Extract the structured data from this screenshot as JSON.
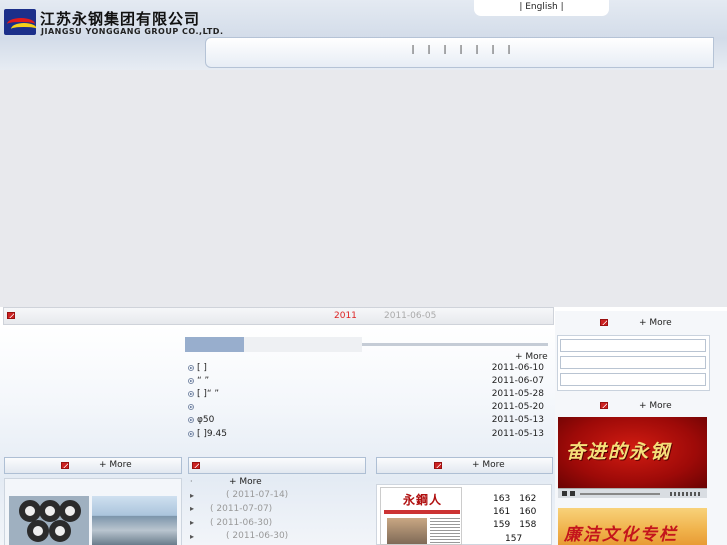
{
  "header": {
    "company_cn": "江苏永钢集团有限公司",
    "company_en": "JIANGSU YONGGANG GROUP CO.,LTD.",
    "lang_link": "| English |",
    "nav_separators": [
      "|",
      "|",
      "|",
      "|",
      "|",
      "|",
      "|"
    ]
  },
  "notice": {
    "year": "2011",
    "date": "2011-06-05"
  },
  "news": {
    "more_label": "+ More",
    "items": [
      {
        "title": "[ ]",
        "date": "2011-06-10"
      },
      {
        "title": "“ ”",
        "date": "2011-06-07"
      },
      {
        "title": "[ ]“ ”",
        "date": "2011-05-28"
      },
      {
        "title": "",
        "date": "2011-05-20"
      },
      {
        "title": "φ50",
        "date": "2011-05-13"
      },
      {
        "title": "[ ]9.45",
        "date": "2011-05-13"
      }
    ]
  },
  "products": {
    "more_label": "+ More"
  },
  "list2": {
    "more_label": "+ More",
    "items": [
      {
        "bullet": "·",
        "date": ""
      },
      {
        "bullet": "▸",
        "date": "( 2011-07-14)"
      },
      {
        "bullet": "▸",
        "date": "( 2011-07-07)"
      },
      {
        "bullet": "▸",
        "date": "( 2011-06-30)"
      },
      {
        "bullet": "▸",
        "date": "( 2011-06-30)"
      }
    ]
  },
  "newspaper": {
    "more_label": "+ More",
    "masthead": "永鋼人",
    "issues": [
      [
        "163",
        "162"
      ],
      [
        "161",
        "160"
      ],
      [
        "159",
        "158"
      ],
      [
        "157"
      ]
    ]
  },
  "right": {
    "more_label_1": "+ More",
    "more_label_2": "+ More",
    "video_caption": "奋进的永钢",
    "integrity_caption": "廉洁文化专栏"
  }
}
